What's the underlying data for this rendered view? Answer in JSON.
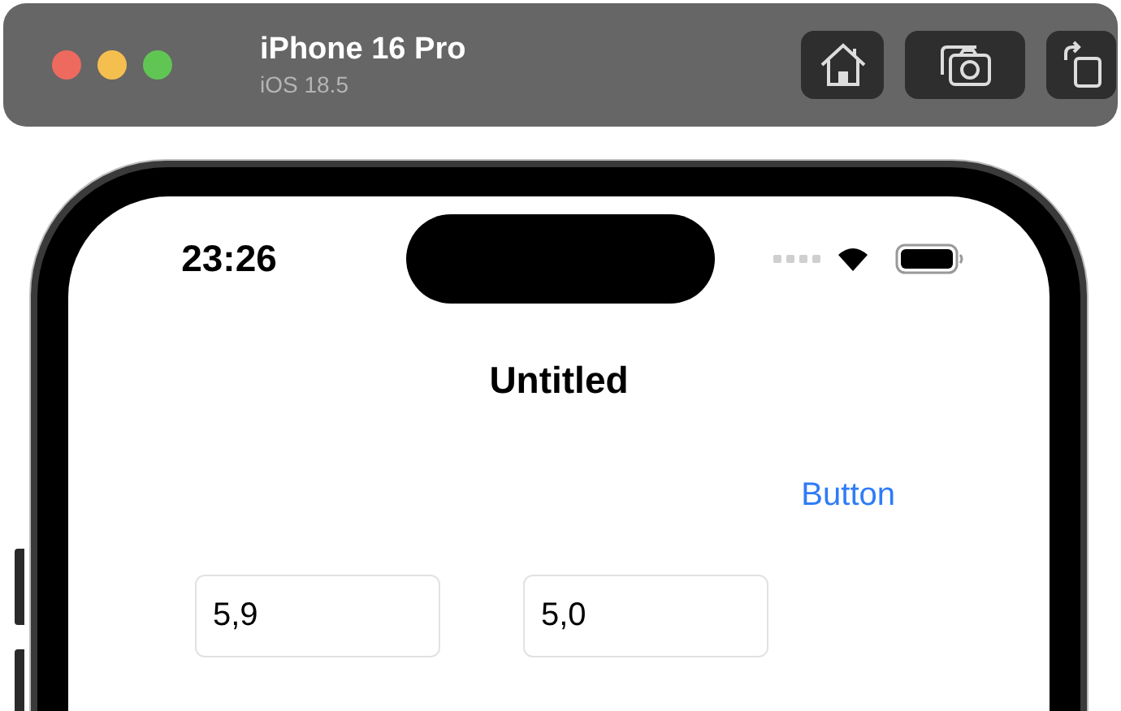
{
  "simulator": {
    "title": "iPhone 16 Pro",
    "subtitle": "iOS 18.5"
  },
  "status_bar": {
    "time": "23:26"
  },
  "navigation": {
    "title": "Untitled"
  },
  "button": {
    "label": "Button"
  },
  "fields": [
    {
      "value": "5,9"
    },
    {
      "value": "5,0"
    }
  ]
}
